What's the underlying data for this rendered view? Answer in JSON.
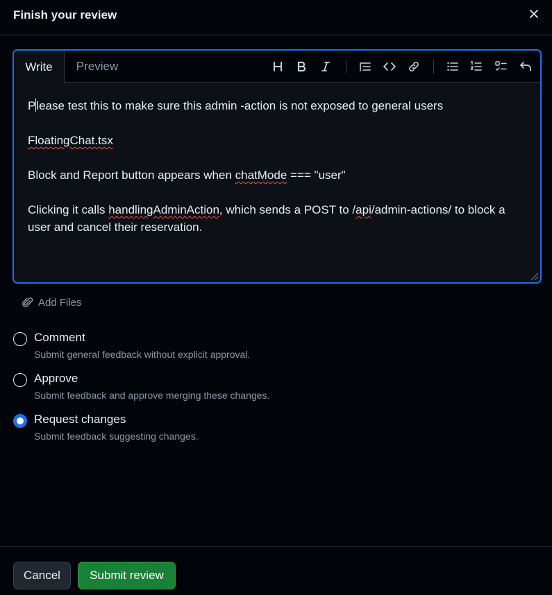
{
  "dialog": {
    "title": "Finish your review"
  },
  "editor": {
    "tabs": [
      {
        "label": "Write",
        "active": true
      },
      {
        "label": "Preview",
        "active": false
      }
    ],
    "toolbar_icons": [
      "heading-icon",
      "bold-icon",
      "italic-icon",
      "quote-icon",
      "code-icon",
      "link-icon",
      "unordered-list-icon",
      "ordered-list-icon",
      "task-list-icon",
      "undo-icon"
    ],
    "content": {
      "line1_pre": "P",
      "line1_post": "lease test this to make sure this admin -action is not exposed to general users",
      "line2": "FloatingChat.tsx",
      "line3_pre": "Block and Report button appears when ",
      "line3_spell": "chatMode",
      "line3_post": " === \"user\"",
      "line4_pre": "Clicking it calls ",
      "line4_spell1": "handlingAdminAction",
      "line4_mid": ", which sends a POST to /",
      "line4_spell2": "api",
      "line4_post": "/admin-actions/ to block a user and cancel their reservation."
    }
  },
  "attachments": {
    "label": "Add Files"
  },
  "review_options": [
    {
      "label": "Comment",
      "description": "Submit general feedback without explicit approval.",
      "checked": false
    },
    {
      "label": "Approve",
      "description": "Submit feedback and approve merging these changes.",
      "checked": false
    },
    {
      "label": "Request changes",
      "description": "Submit feedback suggesting changes.",
      "checked": true
    }
  ],
  "footer": {
    "cancel_label": "Cancel",
    "submit_label": "Submit review"
  },
  "colors": {
    "background": "#010409",
    "accent": "#1f6feb",
    "submit": "#1a7f37",
    "spellcheck": "#f85149"
  }
}
